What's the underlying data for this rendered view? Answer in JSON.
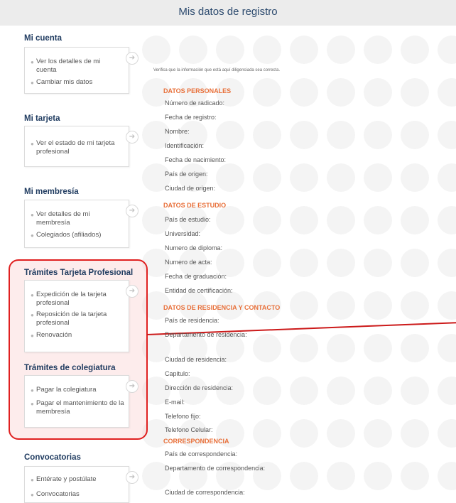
{
  "header": {
    "title": "Mis datos de registro"
  },
  "sidebar": {
    "sections": [
      {
        "title": "Mi cuenta",
        "items": [
          "Ver los detalles de mi cuenta",
          "Cambiar mis datos"
        ]
      },
      {
        "title": "Mi tarjeta",
        "items": [
          "Ver el estado de mi tarjeta profesional"
        ]
      },
      {
        "title": "Mi membresía",
        "items": [
          "Ver detalles de mi membresía",
          "Colegiados (afiliados)"
        ]
      },
      {
        "title": "Trámites Tarjeta Profesional",
        "items": [
          "Expedición de la tarjeta profesional",
          "Reposición de la tarjeta profesional",
          "Renovación"
        ]
      },
      {
        "title": "Trámites de colegiatura",
        "items": [
          "Pagar la colegiatura",
          "Pagar el mantenimiento de la membresía"
        ]
      },
      {
        "title": "Convocatorias",
        "items": [
          "Entérate y postúlate",
          "Convocatorias"
        ]
      }
    ]
  },
  "main": {
    "intro": "Verifica que la información que está aquí diligenciada sea correcta.",
    "sections": [
      {
        "heading": "DATOS PERSONALES",
        "fields": [
          "Número de radicado:",
          "Fecha de registro:",
          "Nombre:",
          "Identificación:",
          "Fecha de nacimiento:",
          "País de origen:",
          "Ciudad de origen:"
        ]
      },
      {
        "heading": "DATOS DE ESTUDIO",
        "fields": [
          "País de estudio:",
          "Universidad:",
          "Numero de diploma:",
          "Numero de acta:",
          "Fecha de graduación:",
          "Entidad de certificación:"
        ]
      },
      {
        "heading": "DATOS DE RESIDENCIA Y CONTACTO",
        "fields": [
          "País de residencia:",
          "Departamento de residencia:",
          "Ciudad de residencia:",
          "Capitulo:",
          "Dirección de residencia:",
          "E-mail:",
          "Telefono fijo:",
          "Telefono Celular:"
        ]
      },
      {
        "heading": "CORRESPONDENCIA",
        "fields": [
          "País de correspondencia:",
          "Departamento de correspondencia:",
          "Ciudad de correspondencia:"
        ]
      }
    ]
  },
  "colors": {
    "accent": "#e8703a",
    "title": "#1e3a5f",
    "highlight": "#e02020"
  }
}
